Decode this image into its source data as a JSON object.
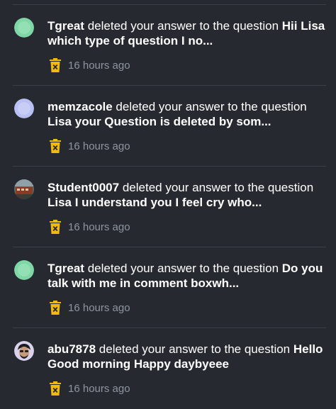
{
  "notifications": [
    {
      "username": "Tgreat",
      "action": "deleted your answer to the question",
      "question": "Hii Lisa which type of question I no...",
      "time": "16 hours ago",
      "avatar_icon": "default-avatar-green",
      "avatar_color": "#7fd6a6"
    },
    {
      "username": "memzacole",
      "action": "deleted your answer to the question",
      "question": "Lisa your Question is deleted by som...",
      "time": "16 hours ago",
      "avatar_icon": "default-avatar-lavender",
      "avatar_color": "#b8bff2"
    },
    {
      "username": "Student0007",
      "action": "deleted your answer to the question",
      "question": "Lisa I understand you I feel cry who...",
      "time": "16 hours ago",
      "avatar_icon": "photo-avatar-train",
      "avatar_color": "#8b3a2a"
    },
    {
      "username": "Tgreat",
      "action": "deleted your answer to the question",
      "question": "Do you talk with me in comment boxwh...",
      "time": "16 hours ago",
      "avatar_icon": "default-avatar-green",
      "avatar_color": "#7fd6a6"
    },
    {
      "username": "abu7878",
      "action": "deleted your answer to the question",
      "question": "Hello Good morning Happy daybyeee",
      "time": "16 hours ago",
      "avatar_icon": "photo-avatar-cartoon",
      "avatar_color": "#d9d2ea"
    }
  ],
  "colors": {
    "background": "#262a30",
    "divider": "#3b4048",
    "text": "#ffffff",
    "muted": "#8f959e",
    "trash_icon": "#f2b90f"
  }
}
